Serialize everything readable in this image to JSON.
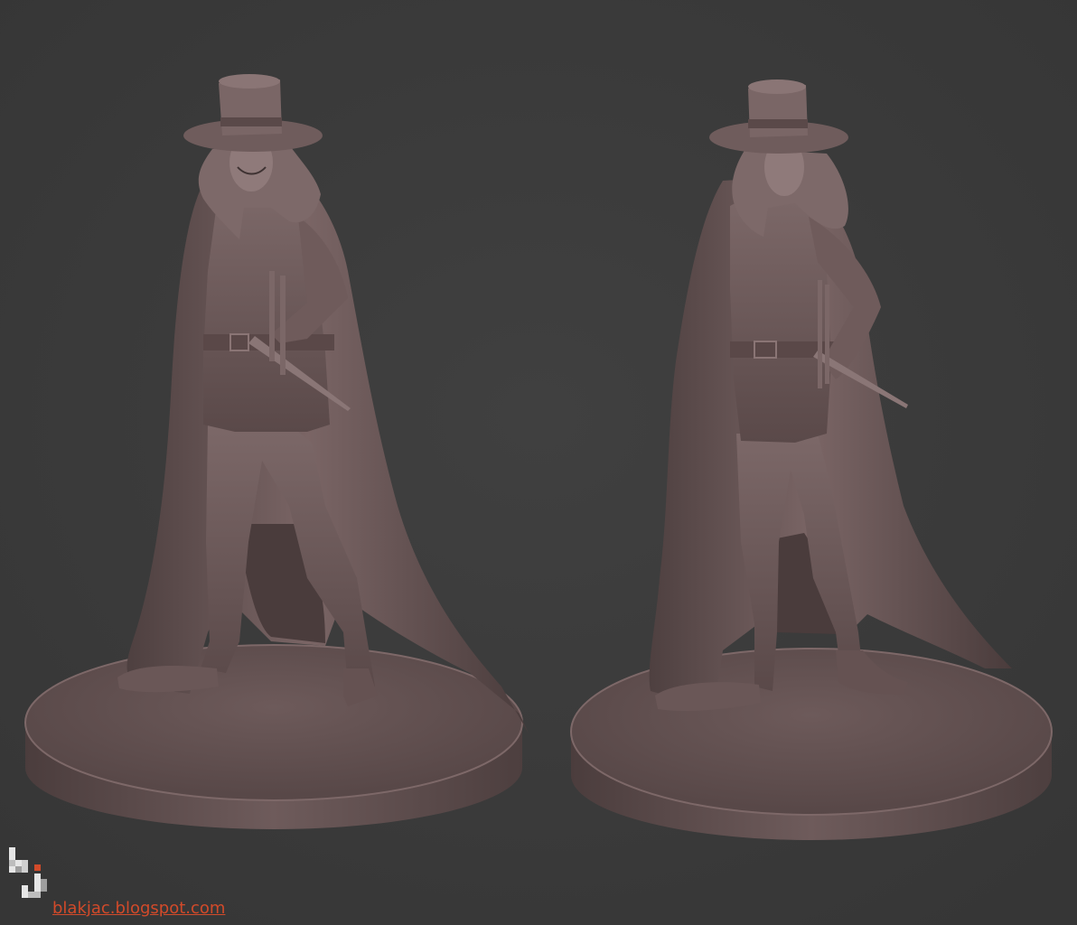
{
  "image": {
    "background_color": "#3b3b3b",
    "clay_color": "#6a5858",
    "clay_highlight": "#8a7474",
    "clay_shadow": "#4a3d3d"
  },
  "figures": [
    {
      "view": "front"
    },
    {
      "view": "three-quarter"
    }
  ],
  "watermark": {
    "logo_icon": "bj-logo-icon",
    "url_text": "blakjac.blogspot.com",
    "accent_color": "#d24a2a"
  }
}
